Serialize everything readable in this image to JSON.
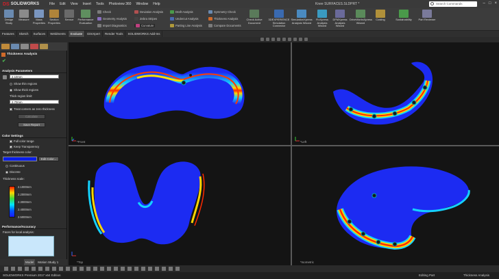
{
  "app": {
    "logo_prefix": "DS",
    "logo_text": "SOLIDWORKS",
    "doc_title": "Knee SURFACES.SLDPRT *",
    "search_placeholder": "Search Commands"
  },
  "menu": [
    "File",
    "Edit",
    "View",
    "Insert",
    "Tools",
    "Photoview 360",
    "Window",
    "Help"
  ],
  "ribbon": {
    "big": [
      "Design Study",
      "Measure",
      "Mass Properties",
      "Section Properties",
      "Sensor",
      "Performance Evaluation"
    ],
    "small_col1": [
      "Check",
      "Geometry Analysis",
      "Import Diagnostics"
    ],
    "small_col2": [
      "Deviation Analysis",
      "Zebra Stripes",
      "Curvature"
    ],
    "small_col3": [
      "Draft Analysis",
      "Undercut Analysis",
      "Parting Line Analysis"
    ],
    "small_col4": [
      "Symmetry Check",
      "Thickness Analysis",
      "Compare Documents"
    ],
    "check_active": "Check Active Document",
    "right": [
      "3DEXPERIENCE Simulation Connector",
      "SimulationXpress Analysis Wizard",
      "FloXpress Analysis Wizard",
      "DFMXpress Analysis Wizard",
      "DriveWorksXpress Wizard",
      "Costing",
      "Sustainability",
      "Part Reviewer"
    ]
  },
  "cmdtabs": [
    "Features",
    "Sketch",
    "Surfaces",
    "Weldments",
    "Evaluate",
    "DimXpert",
    "Render Tools",
    "SOLIDWORKS Add-Ins"
  ],
  "active_cmdtab": "Evaluate",
  "pm": {
    "title": "Thickness Analysis",
    "section_params": "Analysis Parameters",
    "thickness_value": "2.10mm",
    "show_thin": "Show thin regions",
    "show_thick": "Show thick regions",
    "thick_limit_label": "Thick region limit:",
    "thick_limit_value": "2.70mm",
    "treat_corners": "Treat corners as zero thickness",
    "calculate": "Calculate",
    "save_report": "Save Report",
    "section_color": "Color Settings",
    "full_color": "Full color range",
    "keep_transparency": "Keep Transparency",
    "target_color_label": "Target thickness color:",
    "edit_color": "Edit Color...",
    "continuous": "Continuous",
    "discrete": "Discrete",
    "scale_label": "Thickness scale:",
    "scale_values": [
      "2.1000mm",
      "2.2000mm",
      "2.3000mm",
      "2.4000mm",
      "2.5000mm"
    ],
    "section_perf": "Performance/Accuracy",
    "faces_label": "Faces for local analysis:"
  },
  "bottom_tabs": [
    "Model",
    "Motion Study 1"
  ],
  "viewports": [
    "*Front",
    "*Left",
    "*Top",
    "*Isometric"
  ],
  "status": {
    "left": "SOLIDWORKS Premium 2017 x64 Edition",
    "middle": "Editing Part",
    "right": "Thickness Analysis"
  },
  "colors": {
    "accent": "#d2202a",
    "target_color": "#0a1ee6",
    "model_blue": "#1c2bf2"
  }
}
